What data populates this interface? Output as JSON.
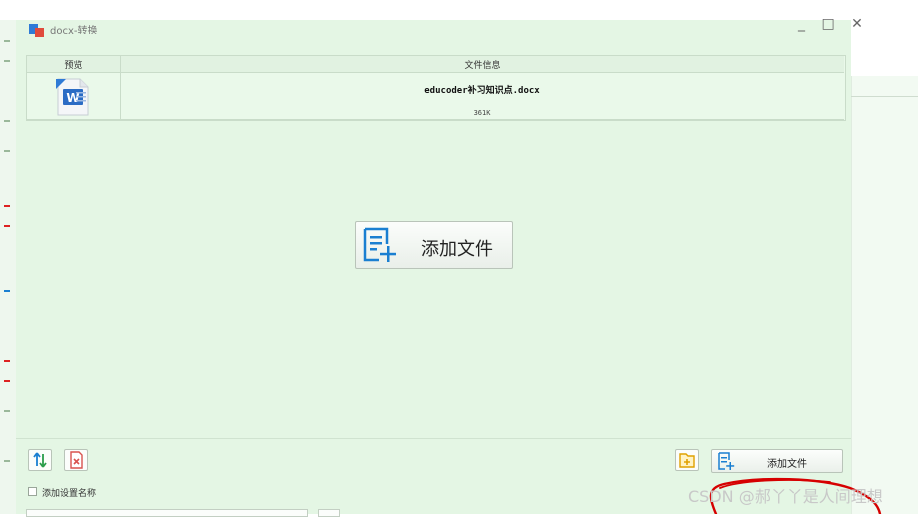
{
  "window": {
    "title": "docx-转换",
    "controls": "_ □ ✕"
  },
  "table": {
    "headers": [
      "预览",
      "文件信息"
    ],
    "rows": [
      {
        "icon": "word-document-icon",
        "filename": "educoder补习知识点.docx",
        "size": "361K"
      }
    ]
  },
  "main": {
    "add_file_label": "添加文件"
  },
  "toolbar": {
    "add_file_label": "添加文件"
  },
  "options": {
    "add_settings_name_label": "添加设置名称",
    "add_settings_name_checked": false
  },
  "watermark": "CSDN @郝丫丫是人间理想",
  "colors": {
    "window_bg": "#e4f6e4",
    "accent_blue": "#1a7fd1",
    "accent_red": "#d9534f",
    "annotation_red": "#d60000"
  }
}
